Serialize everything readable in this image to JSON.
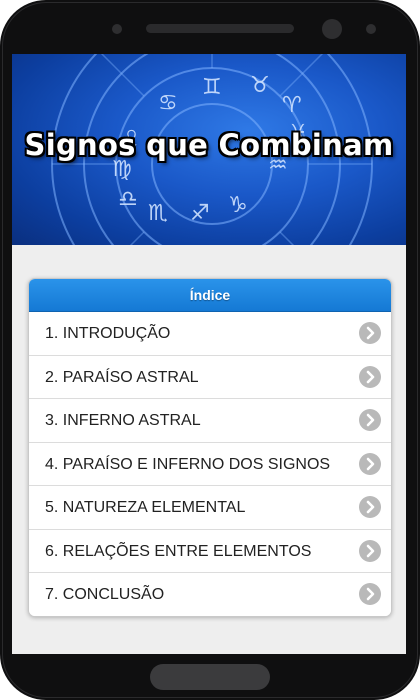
{
  "banner": {
    "title": "Signos que Combinam"
  },
  "index": {
    "header": "Índice",
    "items": [
      {
        "label": "1. INTRODUÇÃO"
      },
      {
        "label": "2. PARAÍSO ASTRAL"
      },
      {
        "label": "3. INFERNO ASTRAL"
      },
      {
        "label": "4. PARAÍSO E INFERNO DOS SIGNOS"
      },
      {
        "label": "5. NATUREZA ELEMENTAL"
      },
      {
        "label": "6. RELAÇÕES ENTRE ELEMENTOS"
      },
      {
        "label": "7. CONCLUSÃO"
      }
    ]
  },
  "colors": {
    "banner_blue": "#1a58c8",
    "header_blue": "#1579d4",
    "chevron_grey": "#b9b9b9"
  },
  "icons": {
    "list_item_action": "chevron-right-icon"
  }
}
